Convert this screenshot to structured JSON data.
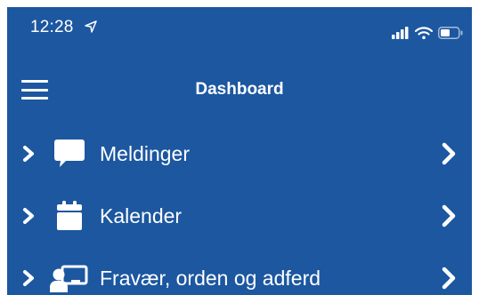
{
  "status_bar": {
    "time": "12:28",
    "icons": [
      "location-arrow-icon",
      "signal-icon",
      "wifi-icon",
      "battery-icon"
    ]
  },
  "nav": {
    "title": "Dashboard",
    "menu_icon": "hamburger-menu-icon"
  },
  "menu": {
    "items": [
      {
        "label": "Meldinger",
        "icon": "message-icon"
      },
      {
        "label": "Kalender",
        "icon": "calendar-icon"
      },
      {
        "label": "Fravær, orden og adferd",
        "icon": "person-board-icon"
      }
    ]
  },
  "colors": {
    "background": "#1c57a0",
    "foreground": "#ffffff"
  }
}
